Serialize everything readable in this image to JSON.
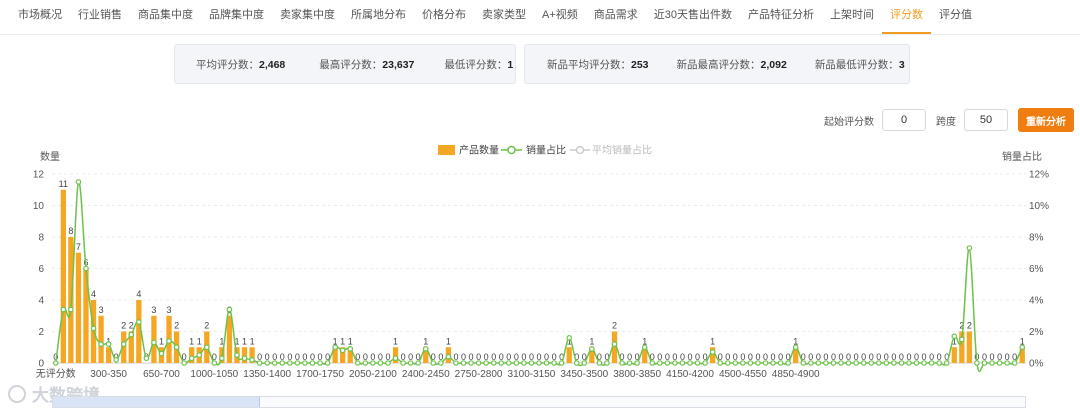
{
  "tabs": [
    "市场概况",
    "行业销售",
    "商品集中度",
    "品牌集中度",
    "卖家集中度",
    "所属地分布",
    "价格分布",
    "卖家类型",
    "A+视频",
    "商品需求",
    "近30天售出件数",
    "产品特征分析",
    "上架时间",
    "评分数",
    "评分值"
  ],
  "active_tab": 13,
  "stats_all": [
    {
      "label": "平均评分数：",
      "value": "2,468"
    },
    {
      "label": "最高评分数：",
      "value": "23,637"
    },
    {
      "label": "最低评分数：",
      "value": "1"
    }
  ],
  "stats_new": [
    {
      "label": "新品平均评分数：",
      "value": "253"
    },
    {
      "label": "新品最高评分数：",
      "value": "2,092"
    },
    {
      "label": "新品最低评分数：",
      "value": "3"
    }
  ],
  "controls": {
    "start_label": "起始评分数",
    "start_value": "0",
    "span_label": "跨度",
    "span_value": "50",
    "button_label": "重新分析"
  },
  "watermark": "大数跨境",
  "colors": {
    "bar": "#f5a623",
    "line": "#6cc24a",
    "avg": "#cccccc",
    "accent": "#f29b22",
    "button": "#ef7d0f"
  },
  "chart_data": {
    "type": "bar",
    "ylabel": "数量",
    "y2label": "销量占比",
    "ylim": [
      0,
      12
    ],
    "y2lim": [
      0,
      12
    ],
    "yticks": [
      0,
      2,
      4,
      6,
      8,
      10,
      12
    ],
    "y2ticks": [
      "0%",
      "2%",
      "4%",
      "6%",
      "8%",
      "10%",
      "12%"
    ],
    "x_tick_labels": [
      "无评分数",
      "300-350",
      "650-700",
      "1000-1050",
      "1350-1400",
      "1700-1750",
      "2050-2100",
      "2400-2450",
      "2750-2800",
      "3100-3150",
      "3450-3500",
      "3800-3850",
      "4150-4200",
      "4500-4550",
      "4850-4900"
    ],
    "legend": [
      "产品数量",
      "销量占比",
      "平均销量占比"
    ],
    "legend_position": "top-center",
    "grid": true,
    "series": [
      {
        "name": "产品数量",
        "values": [
          0,
          11,
          8,
          7,
          6,
          4,
          3,
          1,
          0,
          2,
          2,
          4,
          0,
          3,
          1,
          3,
          2,
          0,
          1,
          1,
          2,
          0,
          1,
          3,
          1,
          1,
          1,
          0,
          0,
          0,
          0,
          0,
          0,
          0,
          0,
          0,
          0,
          1,
          1,
          1,
          0,
          0,
          0,
          0,
          0,
          1,
          0,
          0,
          0,
          1,
          0,
          0,
          1,
          0,
          0,
          0,
          0,
          0,
          0,
          0,
          0,
          0,
          0,
          0,
          0,
          0,
          0,
          0,
          1,
          0,
          0,
          1,
          0,
          0,
          2,
          0,
          0,
          0,
          1,
          0,
          0,
          0,
          0,
          0,
          0,
          0,
          0,
          1,
          0,
          0,
          0,
          0,
          0,
          0,
          0,
          0,
          0,
          0,
          1,
          0,
          0,
          0,
          0,
          0,
          0,
          0,
          0,
          0,
          0,
          0,
          0,
          0,
          0,
          0,
          0,
          0,
          0,
          0,
          0,
          1,
          2,
          2,
          0,
          0,
          0,
          0,
          0,
          0,
          1
        ]
      },
      {
        "name": "销量占比",
        "values": [
          0,
          3.4,
          3.4,
          11.5,
          6,
          2.2,
          1.2,
          1.2,
          0.2,
          1.2,
          1.8,
          2.6,
          0.3,
          1.3,
          0.6,
          1.4,
          1,
          0,
          0.3,
          0.5,
          1,
          0,
          0.3,
          3.4,
          0.5,
          0.3,
          0.2,
          0,
          0,
          0,
          0,
          0,
          0,
          0,
          0,
          0,
          0,
          1,
          0.8,
          0.9,
          0,
          0,
          0,
          0,
          0,
          0.3,
          0,
          0,
          0,
          0.9,
          0,
          0,
          0.4,
          0,
          0,
          0,
          0,
          0,
          0,
          0,
          0,
          0,
          0,
          0,
          0,
          0,
          0,
          0,
          1.6,
          0,
          0,
          0.9,
          0,
          0,
          1.2,
          0,
          0,
          0,
          1,
          0,
          0,
          0,
          0,
          0,
          0,
          0,
          0,
          0.7,
          0,
          0,
          0,
          0,
          0,
          0,
          0,
          0,
          0,
          0,
          1,
          0,
          0,
          0,
          0,
          0,
          0,
          0,
          0,
          0,
          0,
          0,
          0,
          0,
          0,
          0,
          0,
          0,
          0,
          0,
          0,
          1.7,
          1.5,
          7.3,
          0,
          0,
          0,
          0,
          0,
          0,
          1
        ]
      }
    ]
  }
}
